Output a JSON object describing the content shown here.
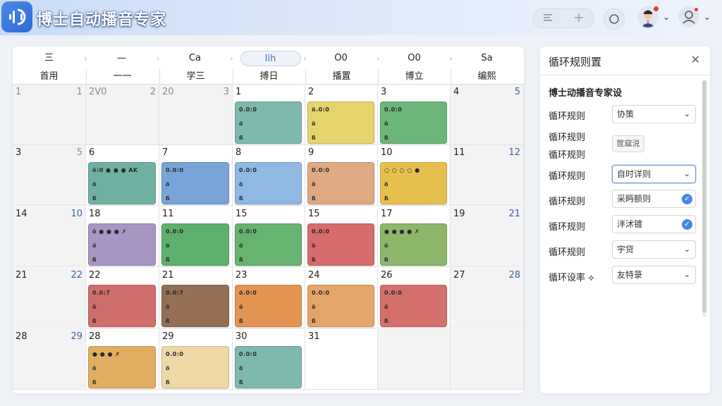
{
  "app": {
    "title": "博士自动播音专家"
  },
  "header": {
    "toolbar_icons": [
      "list-icon",
      "plus-icon"
    ],
    "refresh_icon": "refresh-icon"
  },
  "calendar": {
    "nav": [
      "三",
      "—",
      "Ca",
      "Iih",
      "O0",
      "O0",
      "Sa"
    ],
    "weekdays": [
      "首用",
      "一一",
      "学三",
      "搏日",
      "播置",
      "博立",
      "编熙"
    ],
    "weeks": [
      [
        [
          "1",
          "1"
        ],
        [
          "2V0",
          "2"
        ],
        [
          "20",
          "3"
        ],
        [
          "1",
          ""
        ],
        [
          "2",
          ""
        ],
        [
          "3",
          ""
        ],
        [
          "4",
          "5"
        ]
      ],
      [
        [
          "3",
          "5"
        ],
        [
          "6",
          ""
        ],
        [
          "7",
          ""
        ],
        [
          "8",
          ""
        ],
        [
          "9",
          ""
        ],
        [
          "10",
          ""
        ],
        [
          "11",
          "12"
        ]
      ],
      [
        [
          "14",
          "10"
        ],
        [
          "18",
          ""
        ],
        [
          "11",
          ""
        ],
        [
          "15",
          ""
        ],
        [
          "15",
          ""
        ],
        [
          "17",
          ""
        ],
        [
          "19",
          "21"
        ]
      ],
      [
        [
          "21",
          "22"
        ],
        [
          "22",
          ""
        ],
        [
          "21",
          ""
        ],
        [
          "23",
          ""
        ],
        [
          "24",
          ""
        ],
        [
          "26",
          ""
        ],
        [
          "27",
          "28"
        ]
      ],
      [
        [
          "28",
          "29"
        ],
        [
          "28",
          ""
        ],
        [
          "29",
          ""
        ],
        [
          "30",
          ""
        ],
        [
          "31",
          ""
        ],
        [
          "",
          ""
        ],
        [
          "",
          ""
        ]
      ]
    ],
    "events": [
      {
        "week": 0,
        "day": 3,
        "l1": "0.0:0",
        "l2": "ö",
        "l3": "ß"
      },
      {
        "week": 0,
        "day": 4,
        "l1": "ö.0:0",
        "l2": "ö",
        "l3": "ß"
      },
      {
        "week": 0,
        "day": 5,
        "l1": "0.0:0",
        "l2": "ö",
        "l3": "ß"
      },
      {
        "week": 1,
        "day": 1,
        "l1": "ö:0 ● ● ● AK",
        "l2": "ö",
        "l3": "ß"
      },
      {
        "week": 1,
        "day": 2,
        "l1": "0.0:0",
        "l2": "ö",
        "l3": "ß"
      },
      {
        "week": 1,
        "day": 3,
        "l1": "0.0:0",
        "l2": "ö",
        "l3": "ß"
      },
      {
        "week": 1,
        "day": 4,
        "l1": "0.0:0",
        "l2": "ö",
        "l3": "ß"
      },
      {
        "week": 1,
        "day": 5,
        "l1": "○ ○ ○ ○ ●",
        "l2": "ö",
        "l3": "ß"
      },
      {
        "week": 2,
        "day": 1,
        "l1": "ö ● ● ● ✗",
        "l2": "ö",
        "l3": "ß"
      },
      {
        "week": 2,
        "day": 2,
        "l1": "0.0:0",
        "l2": "ö",
        "l3": "ß"
      },
      {
        "week": 2,
        "day": 3,
        "l1": "0.0:0",
        "l2": "ö",
        "l3": "ß"
      },
      {
        "week": 2,
        "day": 4,
        "l1": "0.0:0",
        "l2": "ö",
        "l3": "ß"
      },
      {
        "week": 2,
        "day": 5,
        "l1": "● ● ● ● ✗",
        "l2": "ö",
        "l3": "ß"
      },
      {
        "week": 3,
        "day": 1,
        "l1": "0.0:7",
        "l2": "ö",
        "l3": "ß"
      },
      {
        "week": 3,
        "day": 2,
        "l1": "0.0:7",
        "l2": "ö",
        "l3": "ß"
      },
      {
        "week": 3,
        "day": 3,
        "l1": "ö.0:0",
        "l2": "ö",
        "l3": "ß"
      },
      {
        "week": 3,
        "day": 4,
        "l1": "0.0:0",
        "l2": "ö",
        "l3": "ß"
      },
      {
        "week": 3,
        "day": 5,
        "l1": "0.0:0",
        "l2": "ö",
        "l3": "ß"
      },
      {
        "week": 4,
        "day": 1,
        "l1": "● ● ● ✗",
        "l2": "ö",
        "l3": "ß"
      },
      {
        "week": 4,
        "day": 2,
        "l1": "0.0:0",
        "l2": "ö",
        "l3": "ß"
      },
      {
        "week": 4,
        "day": 3,
        "l1": "0.0:0",
        "l2": "ö",
        "l3": "ß"
      }
    ],
    "event_colors": [
      "#7fb9ae",
      "#e6d36c",
      "#6bb678",
      "#6fb0a2",
      "#79a4d8",
      "#8fb8e2",
      "#dea983",
      "#e5c04e",
      "#a796c4",
      "#5eb06d",
      "#66b46f",
      "#d86c6c",
      "#8db66a",
      "#cf6e6b",
      "#946f53",
      "#e49452",
      "#e5a46a",
      "#d3706c",
      "#e1ad61",
      "#eed9a6"
    ]
  },
  "panel": {
    "title": "循环规则置",
    "close_label": "✕",
    "section_title": "博士动播音专家设",
    "rows": [
      {
        "label": "循环规则",
        "value": "协策",
        "type": "select"
      },
      {
        "label": "循环规则",
        "value": "",
        "type": "none"
      },
      {
        "label": "循环规则",
        "value": "笸窳涚",
        "type": "button"
      },
      {
        "label": "循环规则",
        "value": "自时详则",
        "type": "select-focus"
      },
      {
        "label": "循环规则",
        "value": "采眄额则",
        "type": "dot"
      },
      {
        "label": "循环规则",
        "value": "泮沭镀",
        "type": "dot"
      },
      {
        "label": "循环规则",
        "value": "宇贷",
        "type": "select"
      },
      {
        "label": "循环设率 ⟡",
        "value": "友特菉",
        "type": "select"
      }
    ]
  }
}
